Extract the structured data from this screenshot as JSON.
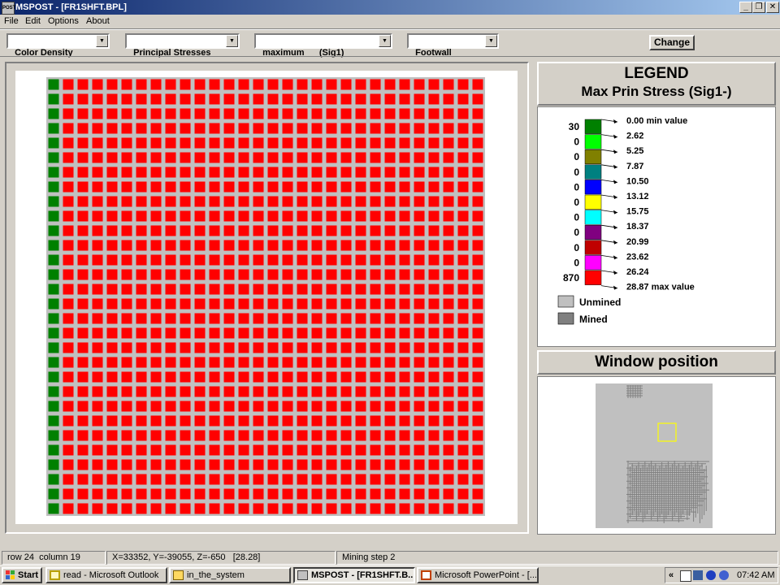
{
  "window": {
    "title": "MSPOST - [FR1SHFT.BPL]",
    "app_icon_text": "POST",
    "minimize_symbol": "_",
    "restore_symbol": "❐",
    "close_symbol": "✕"
  },
  "menu": [
    "File",
    "Edit",
    "Options",
    "About"
  ],
  "toolbar": {
    "display_mode": "Color Density",
    "stress_type": "Principal Stresses",
    "stress_component": "maximum      (Sig1)",
    "surface": "Footwall",
    "change_label": "Change"
  },
  "grid": {
    "rows": 30,
    "columns": 30,
    "first_column_color": "#008000",
    "other_columns_color": "#ff0000",
    "mined_cell_color": "#ff0000",
    "background_color": "#c0c0c0"
  },
  "legend": {
    "title": "LEGEND",
    "subtitle": "Max Prin Stress (Sig1-)",
    "bins": [
      {
        "count": "30",
        "color": "#008000",
        "value": "0.00 min value"
      },
      {
        "count": "0",
        "color": "#00ff00",
        "value": "2.62"
      },
      {
        "count": "0",
        "color": "#808000",
        "value": "5.25"
      },
      {
        "count": "0",
        "color": "#008080",
        "value": "7.87"
      },
      {
        "count": "0",
        "color": "#0000ff",
        "value": "10.50"
      },
      {
        "count": "0",
        "color": "#ffff00",
        "value": "13.12"
      },
      {
        "count": "0",
        "color": "#00ffff",
        "value": "15.75"
      },
      {
        "count": "0",
        "color": "#800080",
        "value": "18.37"
      },
      {
        "count": "0",
        "color": "#c00000",
        "value": "20.99"
      },
      {
        "count": "0",
        "color": "#ff00ff",
        "value": "23.62"
      },
      {
        "count": "870",
        "color": "#ff0000",
        "value": "26.24"
      }
    ],
    "max_value": "28.87 max value",
    "unmined_label": "Unmined",
    "unmined_color": "#c0c0c0",
    "mined_label": "Mined",
    "mined_color": "#808080"
  },
  "window_position": {
    "title": "Window position",
    "map_background": "#c0c0c0",
    "map_lines_color": "#808080",
    "viewport_color": "#ffff00"
  },
  "status": {
    "position": "row 24  column 19",
    "coordinates": "X=33352, Y=-39055, Z=-650   [28.28]",
    "step": "Mining step 2"
  },
  "taskbar": {
    "start": "Start",
    "tasks": [
      {
        "label": "read - Microsoft Outlook",
        "icon": "outlook-icon",
        "active": false
      },
      {
        "label": "in_the_system",
        "icon": "folder-icon",
        "active": false
      },
      {
        "label": "MSPOST - [FR1SHFT.B...",
        "icon": "mspost-icon",
        "active": true
      },
      {
        "label": "Microsoft PowerPoint - [...",
        "icon": "powerpoint-icon",
        "active": false
      }
    ],
    "tray_chevron": "«",
    "clock": "07:42 AM"
  }
}
